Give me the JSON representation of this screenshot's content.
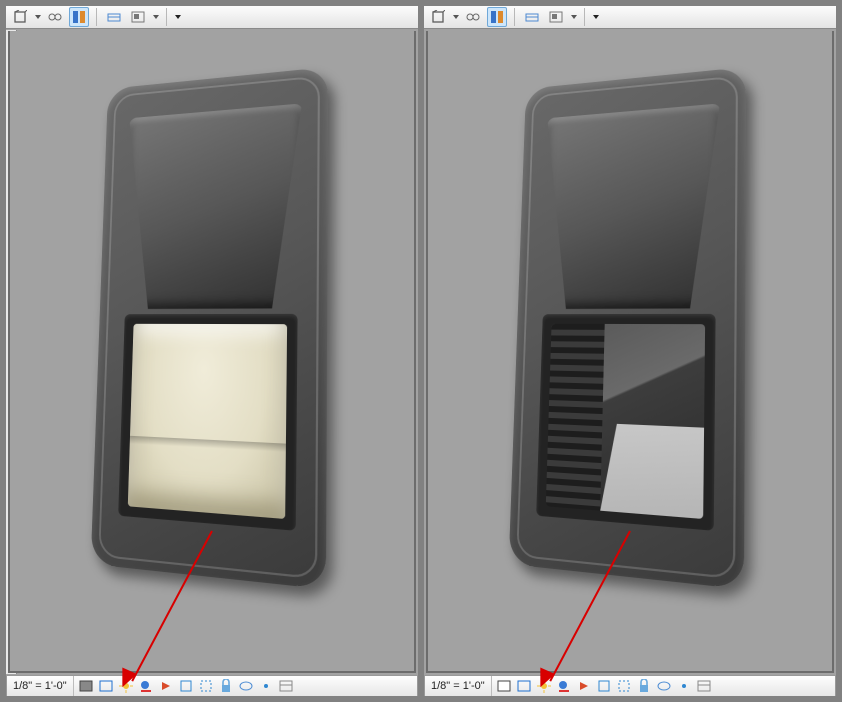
{
  "panes": [
    {
      "scale": "1/8\" = 1'-0\"",
      "highlight_mode": "shaded"
    },
    {
      "scale": "1/8\" = 1'-0\"",
      "highlight_mode": "hidden-line"
    }
  ],
  "toolbar_icons": [
    "view-cube",
    "tri",
    "glasses",
    "sep",
    "thin-lines",
    "sep",
    "detail-level",
    "hide",
    "tri2",
    "overflow"
  ],
  "bottom_icons": [
    "detail-mode",
    "model-graphics",
    "sun",
    "shadows",
    "render",
    "crop",
    "crop2",
    "show-crop",
    "view-lock",
    "temporary",
    "reveal",
    "properties"
  ]
}
